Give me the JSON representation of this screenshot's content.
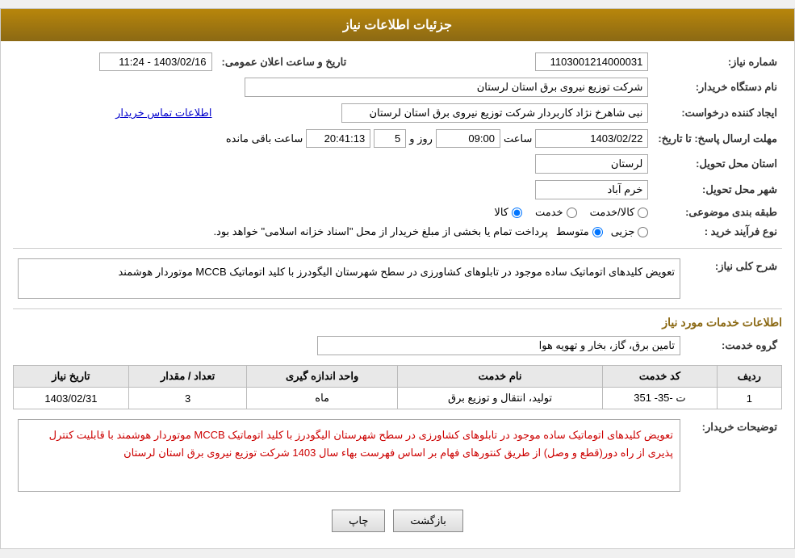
{
  "header": {
    "title": "جزئیات اطلاعات نیاز"
  },
  "fields": {
    "shomara_niaz_label": "شماره نیاز:",
    "shomara_niaz_value": "1103001214000031",
    "nam_dastgah_label": "نام دستگاه خریدار:",
    "nam_dastgah_value": "شرکت توزیع نیروی برق استان لرستان",
    "ijad_label": "ایجاد کننده درخواست:",
    "ijad_value": "نبی شاهرخ نژاد کاربردار شرکت توزیع نیروی برق استان لرستان",
    "ijad_link": "اطلاعات تماس خریدار",
    "mohlat_label": "مهلت ارسال پاسخ: تا تاریخ:",
    "date_value": "1403/02/22",
    "saat_label": "ساعت",
    "saat_value": "09:00",
    "rooz_label": "روز و",
    "rooz_value": "5",
    "baqi_label": "ساعت باقی مانده",
    "baqi_value": "20:41:13",
    "tarikh_elaan_label": "تاریخ و ساعت اعلان عمومی:",
    "tarikh_elaan_value": "1403/02/16 - 11:24",
    "ostan_tahvil_label": "استان محل تحویل:",
    "ostan_tahvil_value": "لرستان",
    "shahr_tahvil_label": "شهر محل تحویل:",
    "shahr_tahvil_value": "خرم آباد",
    "tabaqe_label": "طبقه بندی موضوعی:",
    "tabaqe_kala": "کالا",
    "tabaqe_khedmat": "خدمت",
    "tabaqe_kala_khedmat": "کالا/خدمت",
    "navae_farayand_label": "نوع فرآیند خرید :",
    "navae_jozii": "جزیی",
    "navae_motavaset": "متوسط",
    "navae_note": "پرداخت تمام یا بخشی از مبلغ خریدار از محل \"اسناد خزانه اسلامی\" خواهد بود.",
    "sharh_label": "شرح کلی نیاز:",
    "sharh_value": "تعویض کلیدهای اتوماتیک ساده موجود در تابلوهای کشاورزی در سطح شهرستان الیگودرز با کلید اتوماتیک MCCB موتوردار هوشمند",
    "ettelaat_khadamat_label": "اطلاعات خدمات مورد نیاز",
    "gorohe_khadamat_label": "گروه خدمت:",
    "gorohe_khadamat_value": "تامین برق، گاز، بخار و تهویه هوا",
    "table_headers": {
      "radif": "ردیف",
      "code": "کد خدمت",
      "name": "نام خدمت",
      "unit": "واحد اندازه گیری",
      "count": "تعداد / مقدار",
      "date": "تاریخ نیاز"
    },
    "table_rows": [
      {
        "radif": "1",
        "code": "ت -35- 351",
        "name": "تولید، انتقال و توزیع برق",
        "unit": "ماه",
        "count": "3",
        "date": "1403/02/31"
      }
    ],
    "tosif_label": "توضیحات خریدار:",
    "tosif_value": "تعویض کلیدهای اتوماتیک ساده موجود در تابلوهای کشاورزی در سطح شهرستان الیگودرز با کلید اتوماتیک MCCB موتوردار هوشمند با قابلیت کنترل پذیری از راه دور(قطع و وصل) از طریق کنتورهای فهام بر اساس فهرست بهاء  سال 1403 شرکت توزیع نیروی برق استان لرستان"
  },
  "buttons": {
    "print": "چاپ",
    "back": "بازگشت"
  }
}
